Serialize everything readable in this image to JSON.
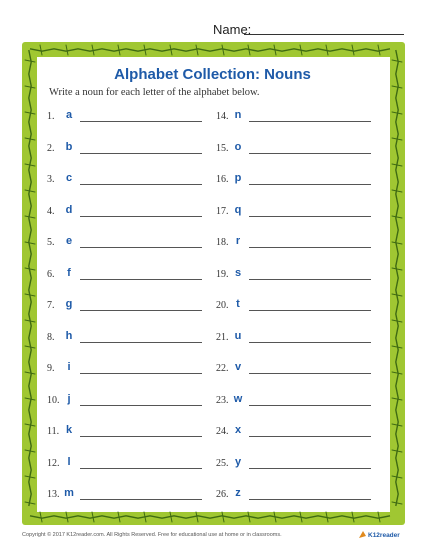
{
  "header": {
    "name_label": "Name:"
  },
  "worksheet": {
    "title": "Alphabet Collection: Nouns",
    "instructions": "Write a noun for each letter of the alphabet below."
  },
  "items": [
    {
      "num": "1.",
      "letter": "a"
    },
    {
      "num": "2.",
      "letter": "b"
    },
    {
      "num": "3.",
      "letter": "c"
    },
    {
      "num": "4.",
      "letter": "d"
    },
    {
      "num": "5.",
      "letter": "e"
    },
    {
      "num": "6.",
      "letter": "f"
    },
    {
      "num": "7.",
      "letter": "g"
    },
    {
      "num": "8.",
      "letter": "h"
    },
    {
      "num": "9.",
      "letter": "i"
    },
    {
      "num": "10.",
      "letter": "j"
    },
    {
      "num": "11.",
      "letter": "k"
    },
    {
      "num": "12.",
      "letter": "l"
    },
    {
      "num": "13.",
      "letter": "m"
    },
    {
      "num": "14.",
      "letter": "n"
    },
    {
      "num": "15.",
      "letter": "o"
    },
    {
      "num": "16.",
      "letter": "p"
    },
    {
      "num": "17.",
      "letter": "q"
    },
    {
      "num": "18.",
      "letter": "r"
    },
    {
      "num": "19.",
      "letter": "s"
    },
    {
      "num": "20.",
      "letter": "t"
    },
    {
      "num": "21.",
      "letter": "u"
    },
    {
      "num": "22.",
      "letter": "v"
    },
    {
      "num": "23.",
      "letter": "w"
    },
    {
      "num": "24.",
      "letter": "x"
    },
    {
      "num": "25.",
      "letter": "y"
    },
    {
      "num": "26.",
      "letter": "z"
    }
  ],
  "footer": {
    "copyright": "Copyright © 2017 K12reader.com. All Rights Reserved. Free for educational use at home or in classrooms.",
    "logo_text": "K12reader"
  },
  "colors": {
    "border_green": "#a0c732",
    "vine_green": "#3f6b12",
    "title_blue": "#1e5aa8"
  }
}
